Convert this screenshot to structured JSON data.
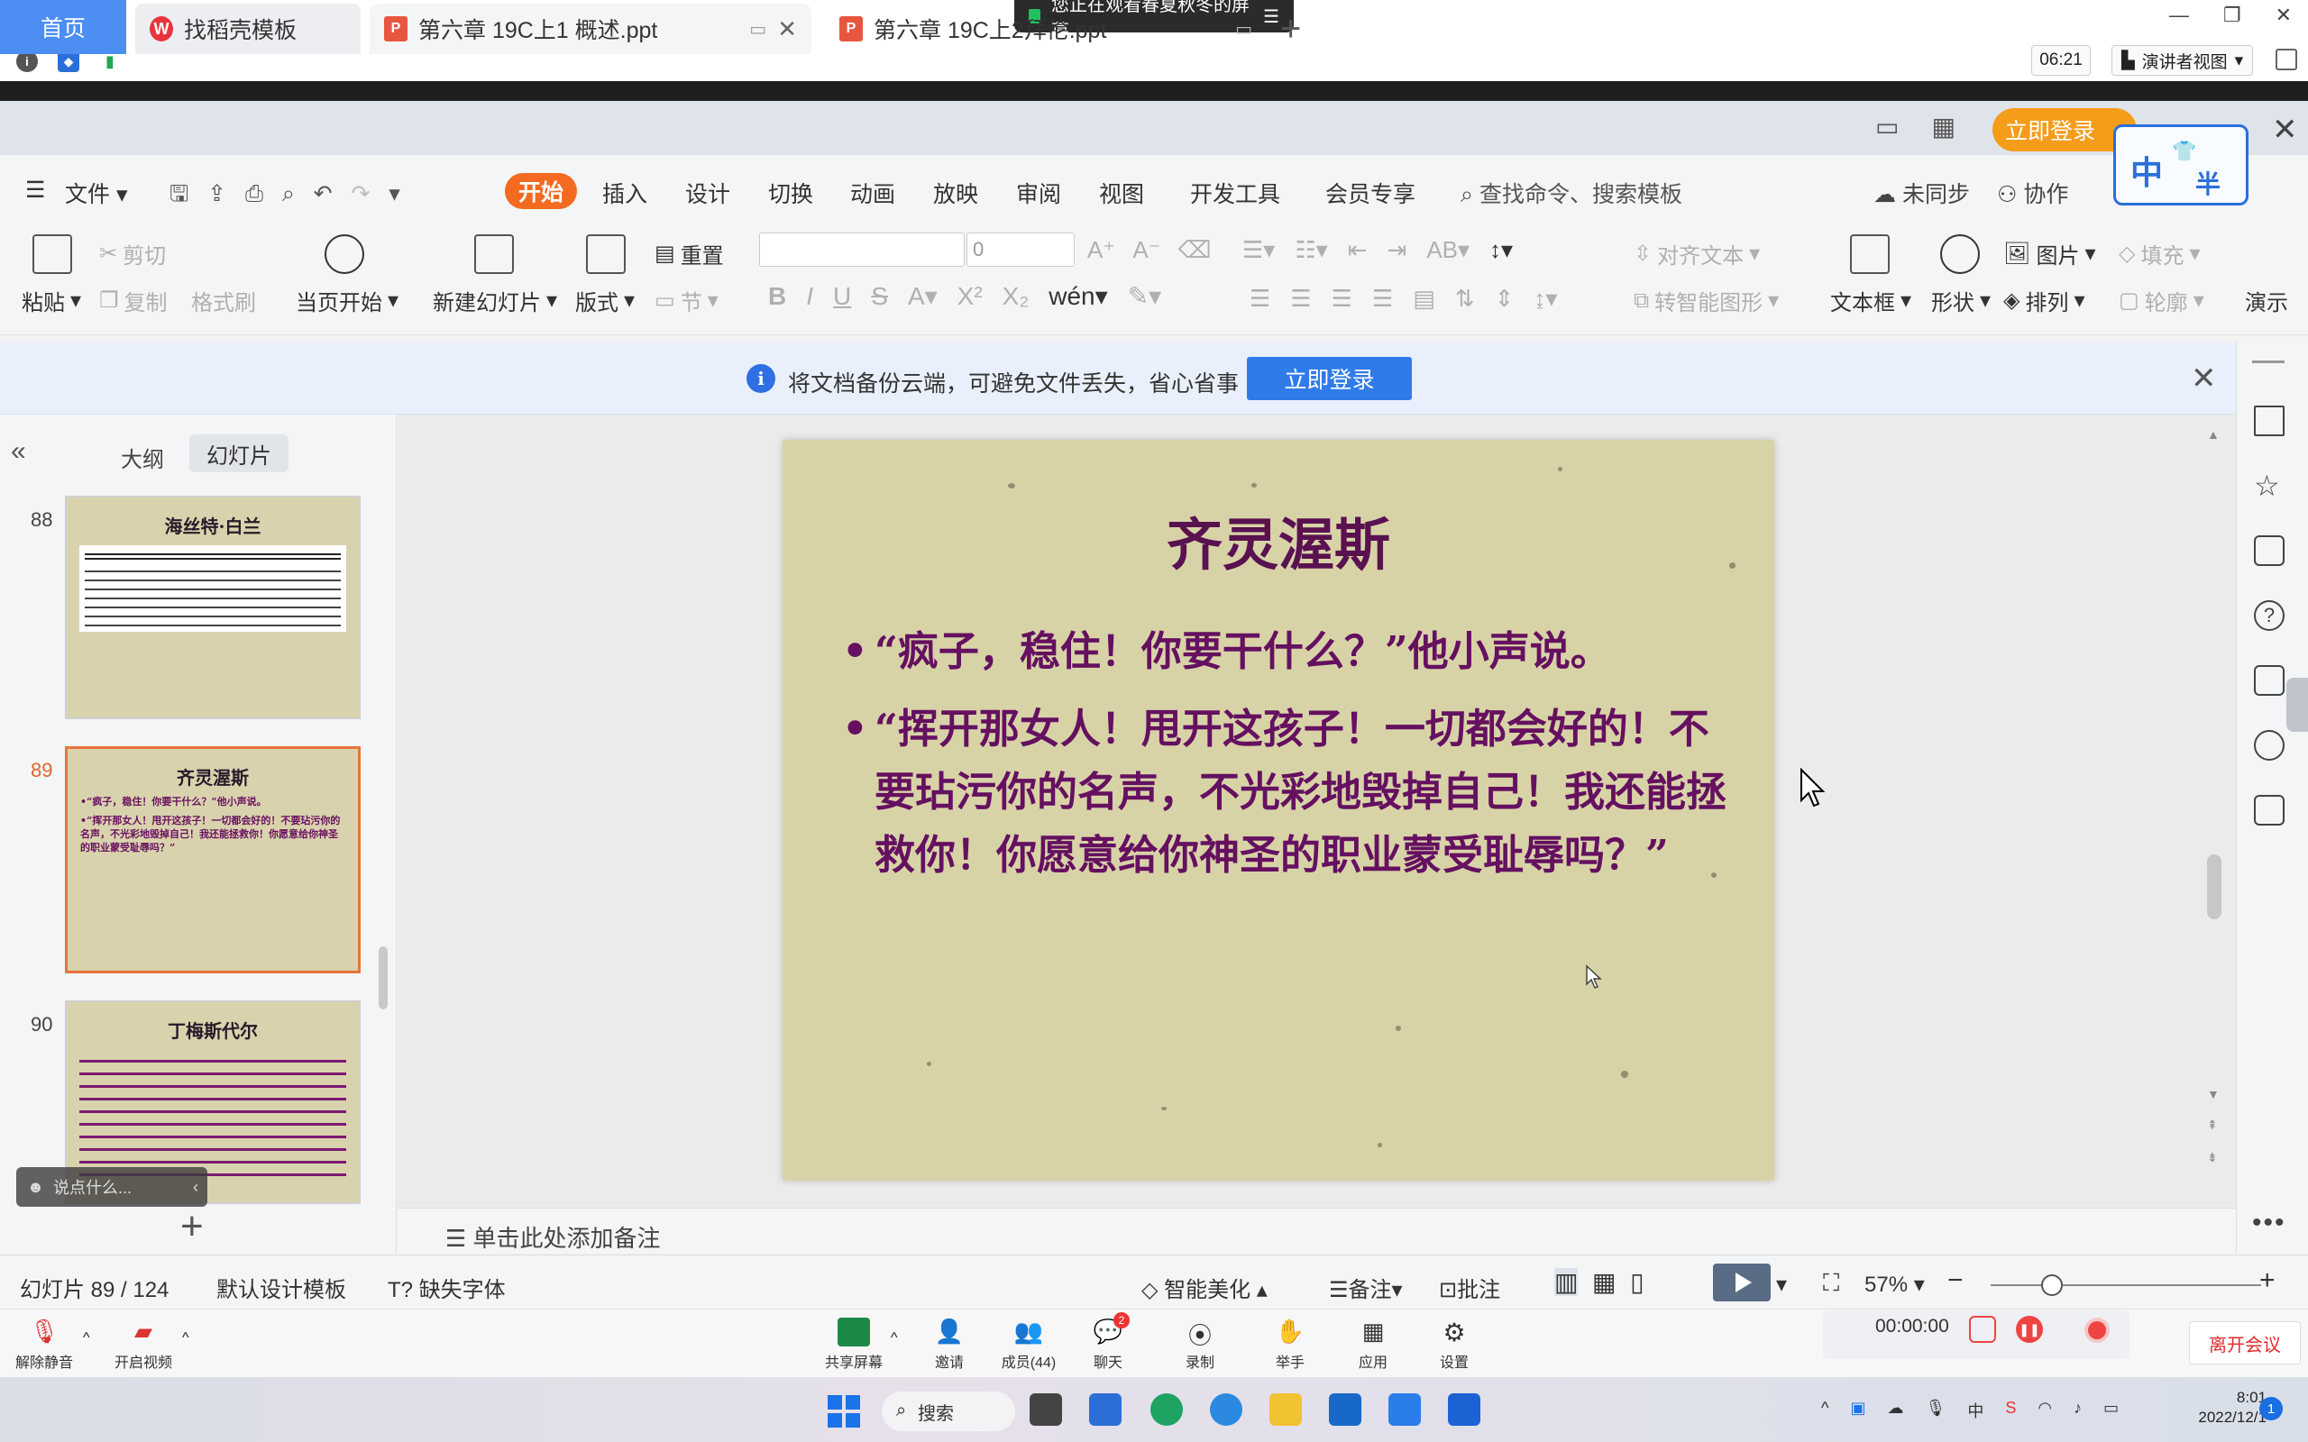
{
  "meeting": {
    "share_banner": "您正在观看春夏秋冬的屏幕",
    "timer": "06:21",
    "presenter_view": "演讲者视图"
  },
  "tabs": {
    "home": "首页",
    "templates": "找稻壳模板",
    "doc1": "第六章 19C上1 概述.ppt",
    "doc2": "第六章 19C上2拜伦.ppt",
    "login": "立即登录"
  },
  "ime": {
    "char_main": "中",
    "char_side": "半"
  },
  "menu": {
    "file": "文件",
    "items": [
      "开始",
      "插入",
      "设计",
      "切换",
      "动画",
      "放映",
      "审阅",
      "视图",
      "开发工具",
      "会员专享"
    ],
    "search": "查找命令、搜索模板",
    "sync": "未同步",
    "collab": "协作"
  },
  "ribbon": {
    "paste": "粘贴",
    "cut": "剪切",
    "copy": "复制",
    "format_painter": "格式刷",
    "from_current": "当页开始",
    "new_slide": "新建幻灯片",
    "layout": "版式",
    "reset": "重置",
    "section": "节",
    "font_size": "0",
    "align_text": "对齐文本",
    "smart_graphic": "转智能图形",
    "picture": "图片",
    "fill": "填充",
    "arrange": "排列",
    "outline": "轮廓",
    "textbox": "文本框",
    "shape": "形状",
    "present": "演示"
  },
  "notification": {
    "text": "将文档备份云端，可避免文件丢失，省心省事",
    "button": "立即登录"
  },
  "left_panel": {
    "tab_outline": "大纲",
    "tab_slides": "幻灯片",
    "thumbs": [
      {
        "num": "88",
        "title": "海丝特·白兰"
      },
      {
        "num": "89",
        "title": "齐灵渥斯",
        "lines": [
          "•“疯子，稳住！你要干什么？”他小声说。",
          "•“挥开那女人！甩开这孩子！一切都会好的！不要玷污你的名声，不光彩地毁掉自己！我还能拯救你！你愿意给你神圣的职业蒙受耻辱吗？”"
        ]
      },
      {
        "num": "90",
        "title": "丁梅斯代尔"
      }
    ],
    "chat_placeholder": "说点什么..."
  },
  "slide": {
    "title": "齐灵渥斯",
    "bullets": [
      "“疯子，稳住！你要干什么？”他小声说。",
      "“挥开那女人！甩开这孩子！一切都会好的！不要玷污你的名声，不光彩地毁掉自己！我还能拯救你！你愿意给你神圣的职业蒙受耻辱吗？”"
    ]
  },
  "notes_placeholder": "单击此处添加备注",
  "status": {
    "slide_counter": "幻灯片 89 / 124",
    "template": "默认设计模板",
    "missing_font": "缺失字体",
    "beautify": "智能美化",
    "notes": "备注",
    "comments": "批注",
    "zoom": "57%"
  },
  "meeting_bar": {
    "unmute": "解除静音",
    "video": "开启视频",
    "share": "共享屏幕",
    "invite": "邀请",
    "members": "成员(44)",
    "chat": "聊天",
    "chat_badge": "2",
    "record": "录制",
    "raise_hand": "举手",
    "apps": "应用",
    "settings": "设置",
    "rec_time": "00:00:00",
    "leave": "离开会议"
  },
  "taskbar": {
    "search": "搜索",
    "time": "8:01",
    "date": "2022/12/1",
    "notif_count": "1",
    "ime": "中"
  },
  "colors": {
    "accent_orange": "#f46a21",
    "accent_blue": "#2f7bea",
    "slide_text": "#651060",
    "slide_bg": "#d8d3a7"
  }
}
